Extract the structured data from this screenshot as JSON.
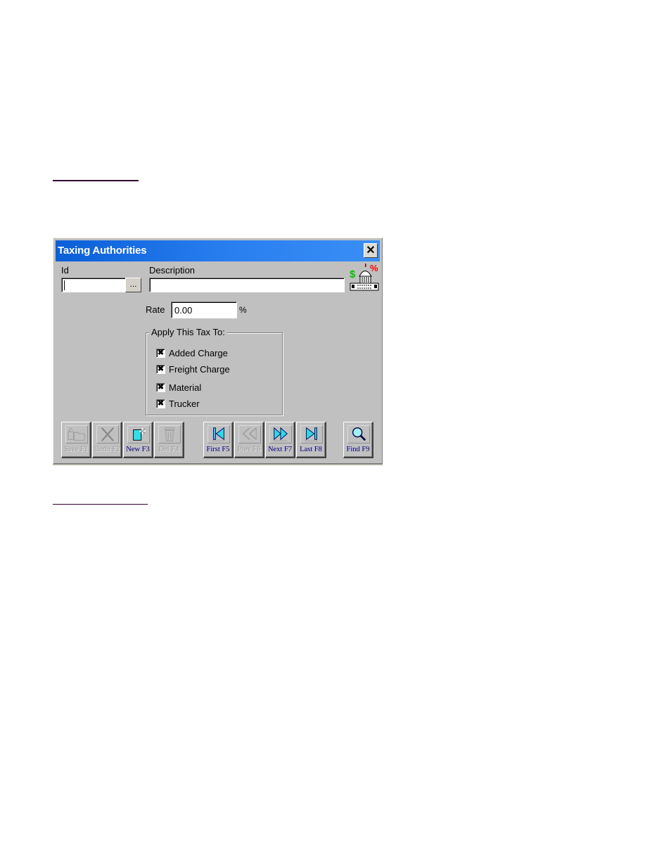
{
  "window": {
    "title": "Taxing Authorities",
    "close_label": "✕"
  },
  "form": {
    "id_label": "Id",
    "id_value": "",
    "lookup_button_label": "...",
    "description_label": "Description",
    "description_value": "",
    "rate_label": "Rate",
    "rate_value": "0.00",
    "rate_unit": "%",
    "apply_group_title": "Apply This Tax To:",
    "apply_items": [
      {
        "label": "Added Charge",
        "checked": true,
        "mark": "✖"
      },
      {
        "label": "Freight Charge",
        "checked": true,
        "mark": "✖"
      },
      {
        "label": "Material",
        "checked": true,
        "mark": "✖"
      },
      {
        "label": "Trucker",
        "checked": true,
        "mark": "✖"
      }
    ]
  },
  "emblem": {
    "icon": "capitol-building-tax-icon",
    "dollar": "$",
    "percent": "%",
    "colors": {
      "dollar": "#00c000",
      "percent": "#ff0000"
    }
  },
  "toolbar": {
    "buttons": [
      {
        "name": "save",
        "label": "Save F1",
        "icon": "save-folder-icon",
        "enabled": false
      },
      {
        "name": "undo",
        "label": "Undo F2",
        "icon": "undo-x-icon",
        "enabled": false
      },
      {
        "name": "new",
        "label": "New F3",
        "icon": "new-document-icon",
        "enabled": true
      },
      {
        "name": "delete",
        "label": "Del F4",
        "icon": "trash-icon",
        "enabled": false
      },
      {
        "name": "first",
        "label": "First F5",
        "icon": "first-record-icon",
        "enabled": true
      },
      {
        "name": "prev",
        "label": "Prev F6",
        "icon": "prev-record-icon",
        "enabled": false
      },
      {
        "name": "next",
        "label": "Next F7",
        "icon": "next-record-icon",
        "enabled": true
      },
      {
        "name": "last",
        "label": "Last F8",
        "icon": "last-record-icon",
        "enabled": true
      },
      {
        "name": "find",
        "label": "Find F9",
        "icon": "magnifier-icon",
        "enabled": true
      }
    ]
  },
  "colors": {
    "titlebar": "#2a7ff0",
    "dialog_bg": "#c0c0c0",
    "enabled_caption": "#000080",
    "rule_line": "#330033"
  }
}
